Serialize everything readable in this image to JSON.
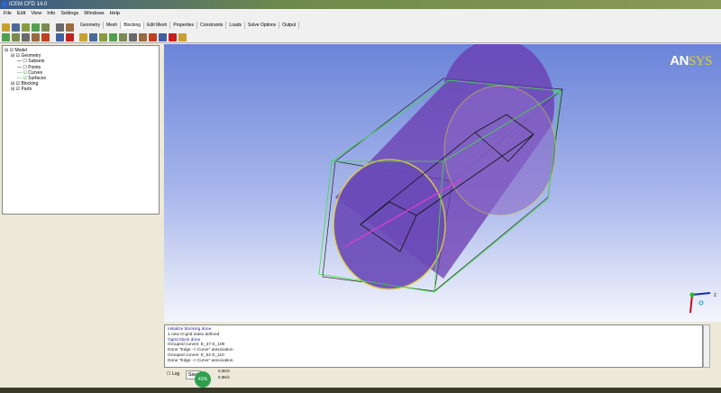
{
  "window": {
    "title": "ICEM CFD 14.0"
  },
  "menu": [
    "File",
    "Edit",
    "View",
    "Info",
    "Settings",
    "Windows",
    "Help"
  ],
  "tabs": [
    "Geometry",
    "Mesh",
    "Blocking",
    "Edit Mesh",
    "Properties",
    "Constraints",
    "Loads",
    "Solve Options",
    "Output"
  ],
  "tree": [
    {
      "label": "Model",
      "level": 0,
      "checked": true
    },
    {
      "label": "Geometry",
      "level": 1,
      "checked": true
    },
    {
      "label": "Subsets",
      "level": 2,
      "checked": false
    },
    {
      "label": "Points",
      "level": 2,
      "checked": false
    },
    {
      "label": "Curves",
      "level": 2,
      "checked": true
    },
    {
      "label": "Surfaces",
      "level": 2,
      "checked": true
    },
    {
      "label": "Blocking",
      "level": 1,
      "checked": true
    },
    {
      "label": "Parts",
      "level": 1,
      "checked": true
    }
  ],
  "logo": {
    "part1": "AN",
    "part2": "SYS"
  },
  "messages": [
    {
      "text": "Initialize blocking done",
      "blue": true
    },
    {
      "text": "1 new O-grid index defined",
      "blue": false
    },
    {
      "text": "Ogrid block done",
      "blue": true
    },
    {
      "text": "Grouped curves: E_47 E_108",
      "blue": false
    },
    {
      "text": "Done \"Edge -> Curve\" association",
      "blue": false
    },
    {
      "text": "Grouped curves: E_52 E_110",
      "blue": false
    },
    {
      "text": "Done \"Edge -> Curve\" association",
      "blue": false
    }
  ],
  "bottom": {
    "log_label": "Log",
    "save_label": "Save",
    "badge": "41%",
    "rate_up": "0.2K/s",
    "rate_down": "0.3K/s"
  },
  "axes": {
    "z_label": "z"
  },
  "colors": {
    "viewport_top": "#6a84d8",
    "cylinder": "#6a3ab0",
    "block_edges": "#40e040"
  }
}
